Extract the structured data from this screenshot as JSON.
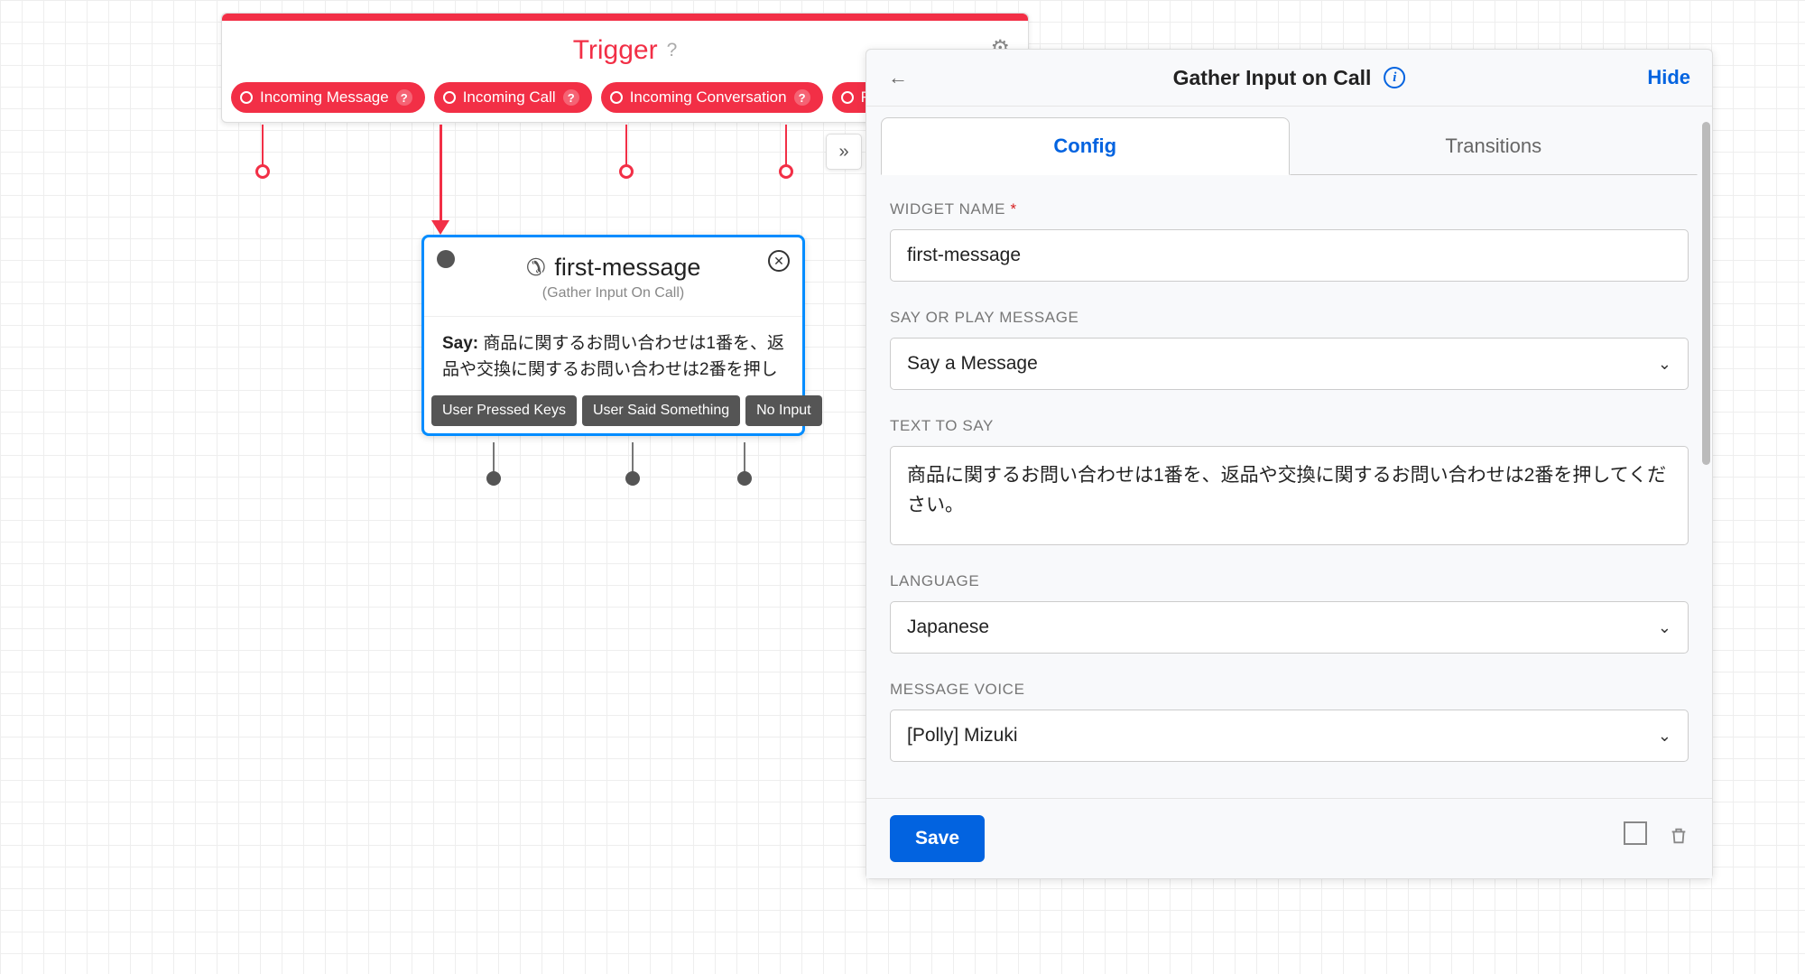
{
  "trigger": {
    "title": "Trigger",
    "outputs": [
      "Incoming Message",
      "Incoming Call",
      "Incoming Conversation",
      "REST AP"
    ]
  },
  "widget": {
    "name": "first-message",
    "subtitle": "(Gather Input On Call)",
    "say_prefix": "Say:",
    "say_text": "商品に関するお問い合わせは1番を、返品や交換に関するお問い合わせは2番を押し",
    "outputs": [
      "User Pressed Keys",
      "User Said Something",
      "No Input"
    ]
  },
  "panel": {
    "title": "Gather Input on Call",
    "hide": "Hide",
    "tabs": {
      "config": "Config",
      "transitions": "Transitions"
    },
    "fields": {
      "widget_name_label": "WIDGET NAME",
      "widget_name_value": "first-message",
      "say_or_play_label": "SAY OR PLAY MESSAGE",
      "say_or_play_value": "Say a Message",
      "text_to_say_label": "TEXT TO SAY",
      "text_to_say_value": "商品に関するお問い合わせは1番を、返品や交換に関するお問い合わせは2番を押してください。",
      "language_label": "LANGUAGE",
      "language_value": "Japanese",
      "voice_label": "MESSAGE VOICE",
      "voice_value": "[Polly] Mizuki"
    },
    "save": "Save"
  }
}
